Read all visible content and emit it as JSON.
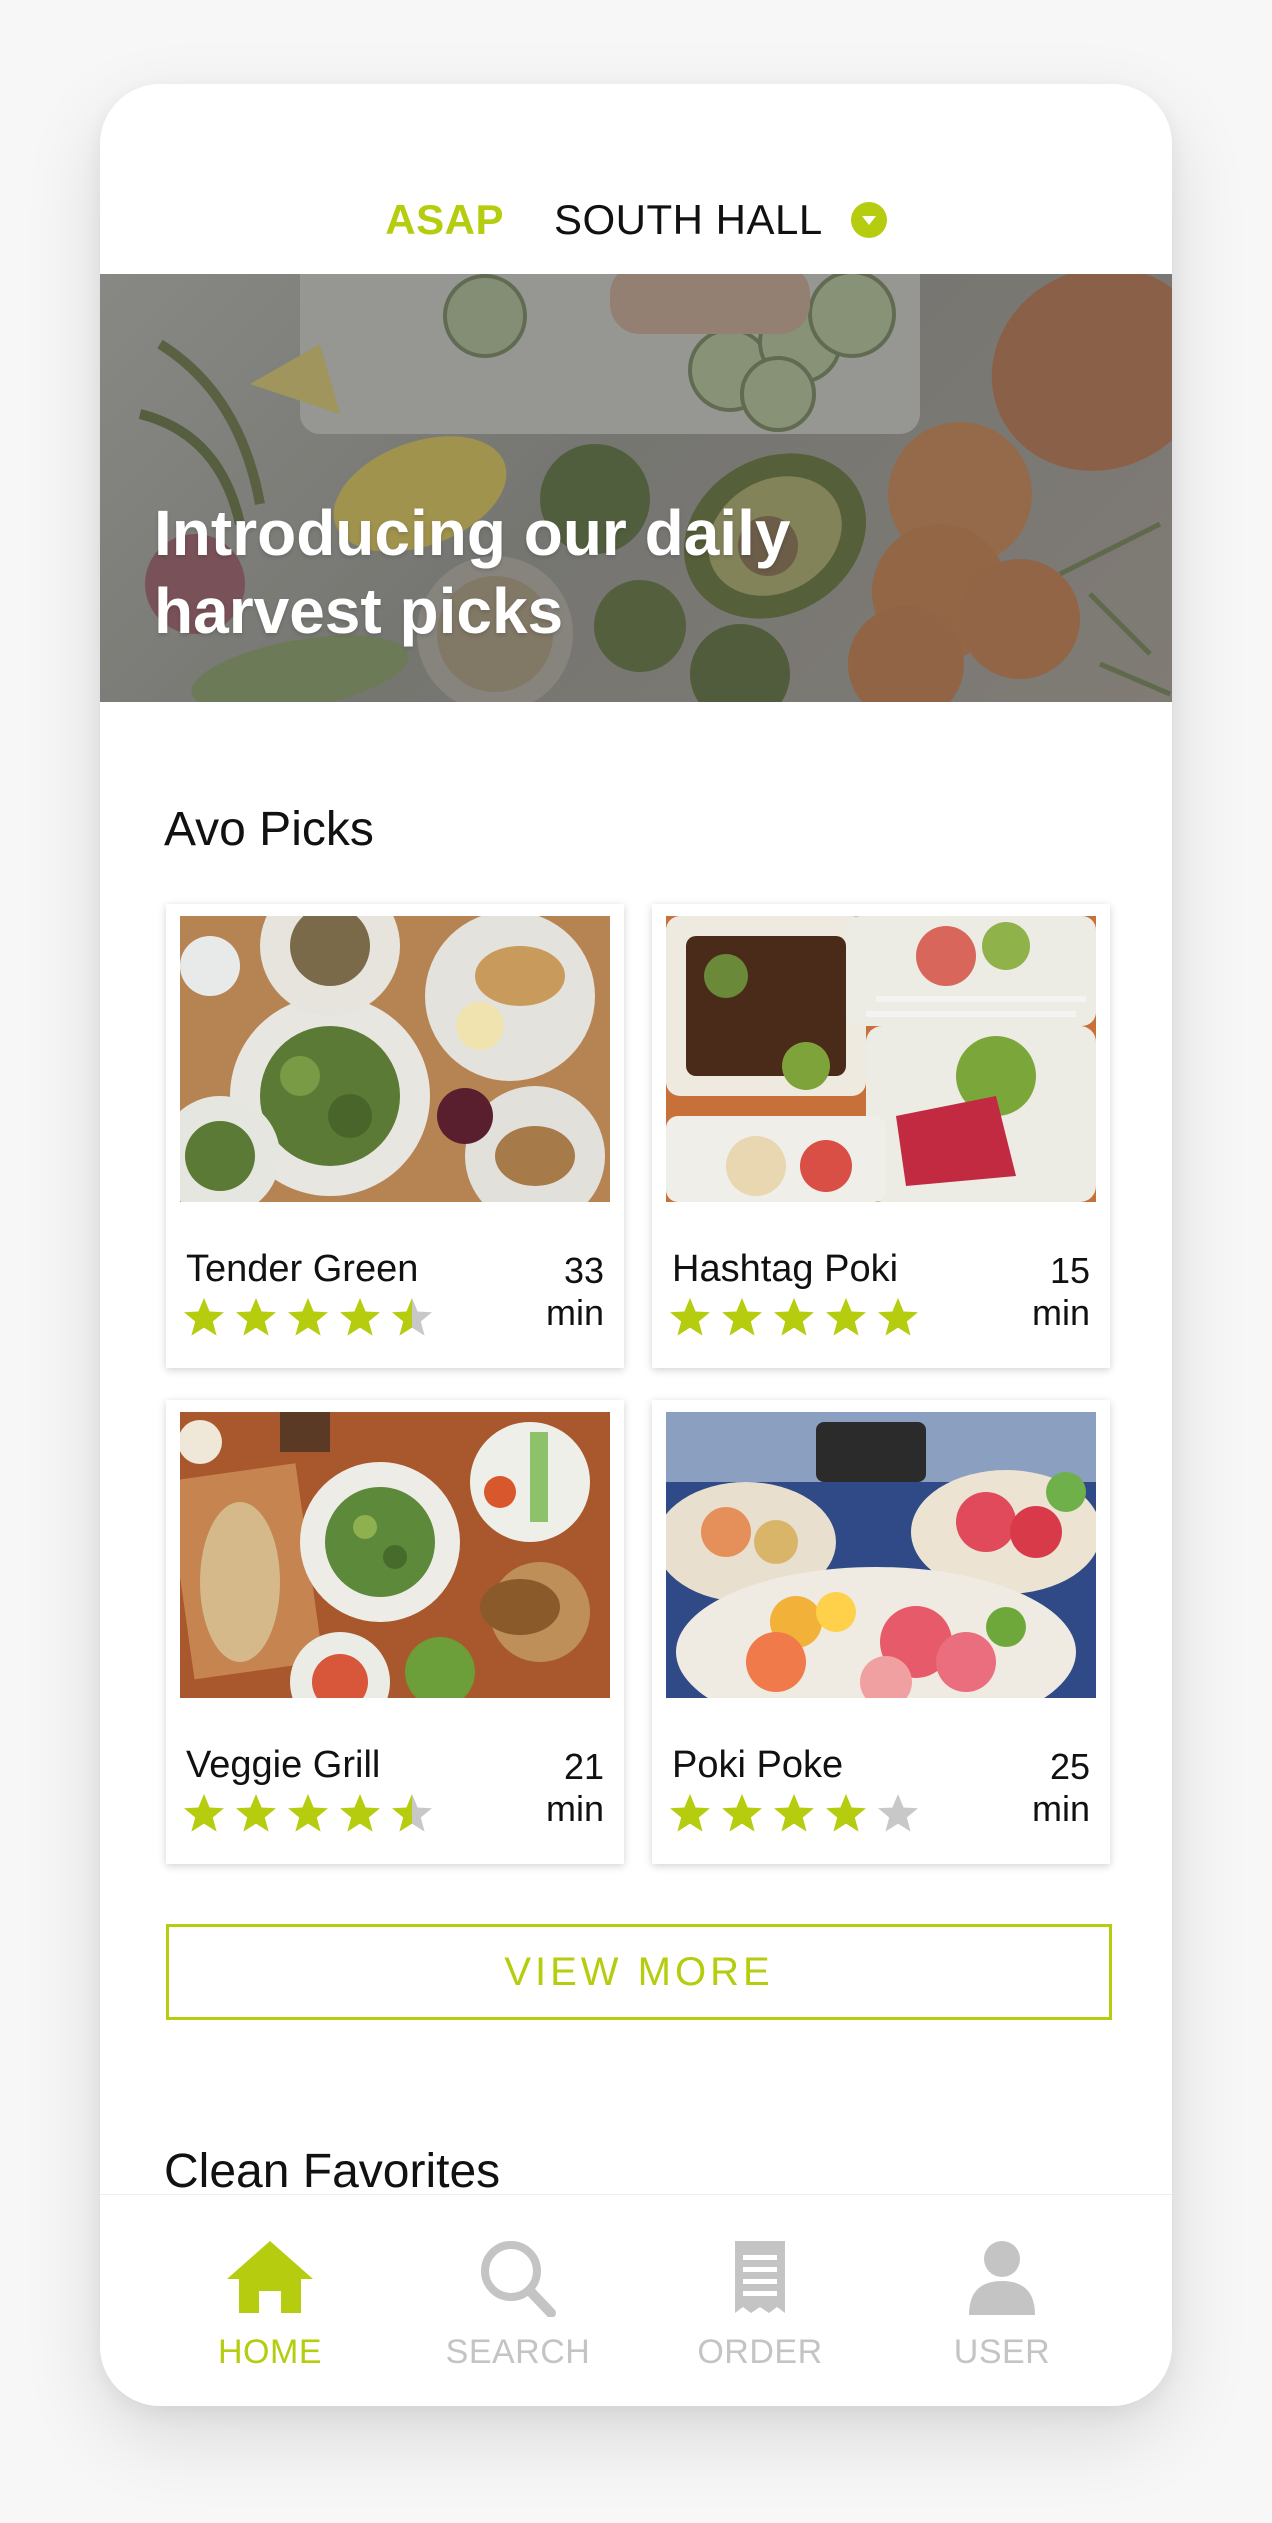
{
  "header": {
    "delivery_time": "ASAP",
    "location": "SOUTH HALL"
  },
  "hero": {
    "title": "Introducing our daily harvest picks"
  },
  "sections": {
    "avo_picks_title": "Avo Picks",
    "clean_favorites_title": "Clean Favorites"
  },
  "restaurants": [
    {
      "name": "Tender Green",
      "time": "33",
      "unit": "min",
      "rating": 4.5
    },
    {
      "name": "Hashtag Poki",
      "time": "15",
      "unit": "min",
      "rating": 5
    },
    {
      "name": "Veggie Grill",
      "time": "21",
      "unit": "min",
      "rating": 4.5
    },
    {
      "name": "Poki Poke",
      "time": "25",
      "unit": "min",
      "rating": 4
    }
  ],
  "view_more_label": "VIEW MORE",
  "tabs": [
    {
      "label": "HOME",
      "icon": "home-icon",
      "active": true
    },
    {
      "label": "SEARCH",
      "icon": "search-icon",
      "active": false
    },
    {
      "label": "ORDER",
      "icon": "receipt-icon",
      "active": false
    },
    {
      "label": "USER",
      "icon": "user-icon",
      "active": false
    }
  ],
  "colors": {
    "accent": "#b5cc0f",
    "inactive": "#c4c4c4",
    "star_empty": "#c8c8c8"
  }
}
